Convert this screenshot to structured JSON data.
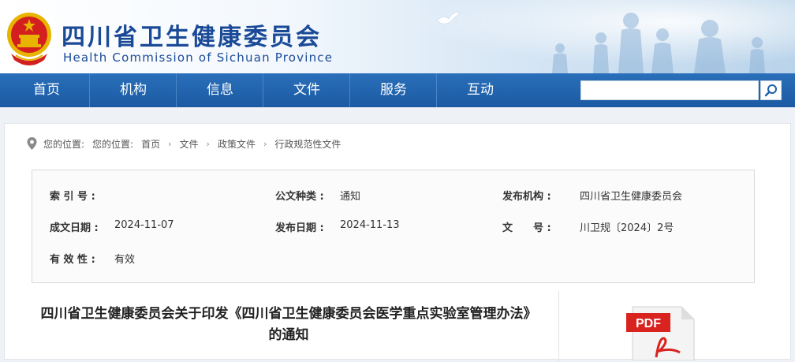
{
  "header": {
    "title_cn": "四川省卫生健康委员会",
    "title_en": "Health Commission of Sichuan Province",
    "emblem_icon": "national-emblem-icon"
  },
  "nav": {
    "items": [
      {
        "label": "首页"
      },
      {
        "label": "机构"
      },
      {
        "label": "信息"
      },
      {
        "label": "文件"
      },
      {
        "label": "服务"
      },
      {
        "label": "互动"
      }
    ],
    "search": {
      "value": "",
      "placeholder": ""
    }
  },
  "breadcrumb": {
    "prefix1": "您的位置:",
    "prefix2": "您的位置:",
    "items": [
      "首页",
      "文件",
      "政策文件",
      "行政规范性文件"
    ]
  },
  "meta": {
    "index_label": "索 引 号 :",
    "index_value": "",
    "type_label": "公文种类 :",
    "type_value": "通知",
    "issuer_label": "发布机构 :",
    "issuer_value": "四川省卫生健康委员会",
    "created_label": "成文日期 :",
    "created_value": "2024-11-07",
    "published_label": "发布日期 :",
    "published_value": "2024-11-13",
    "docno_label": "文　　号 :",
    "docno_value": "川卫规〔2024〕2号",
    "validity_label": "有 效 性 :",
    "validity_value": "有效"
  },
  "document": {
    "title": "四川省卫生健康委员会关于印发《四川省卫生健康委员会医学重点实验室管理办法》的通知",
    "pdf_label": "PDF"
  },
  "colors": {
    "nav_bg": "#1c5ea8",
    "title_blue": "#1a4a97",
    "emblem_red": "#d3201f",
    "emblem_gold": "#e8b400"
  }
}
